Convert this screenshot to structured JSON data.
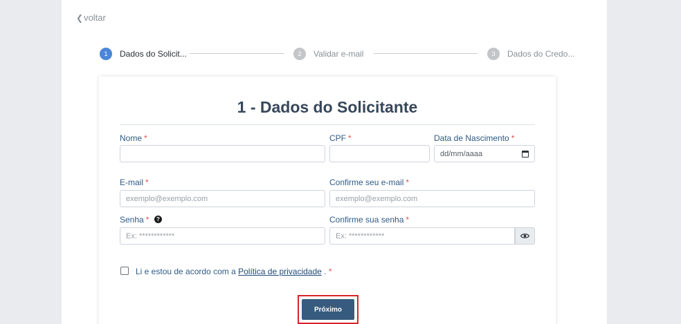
{
  "nav": {
    "back_label": "voltar"
  },
  "stepper": {
    "steps": [
      {
        "number": "1",
        "label": "Dados do Solicit..."
      },
      {
        "number": "2",
        "label": "Validar e-mail"
      },
      {
        "number": "3",
        "label": "Dados do Credo..."
      }
    ],
    "active_step": 1
  },
  "form": {
    "title": "1 - Dados do Solicitante",
    "required_mark": "*",
    "fields": {
      "nome": {
        "label": "Nome",
        "value": "",
        "placeholder": ""
      },
      "cpf": {
        "label": "CPF",
        "value": "",
        "placeholder": ""
      },
      "nascimento": {
        "label": "Data de Nascimento",
        "placeholder": "dd/mm/aaaa"
      },
      "email": {
        "label": "E-mail",
        "placeholder": "exemplo@exemplo.com"
      },
      "email_confirm": {
        "label": "Confirme seu e-mail",
        "placeholder": "exemplo@exemplo.com"
      },
      "senha": {
        "label": "Senha",
        "placeholder": "Ex: ************"
      },
      "senha_confirm": {
        "label": "Confirme sua senha",
        "placeholder": "Ex: ************"
      }
    },
    "consent": {
      "text_before": "Li e estou de acordo com a ",
      "link_text": "Política de privacidade",
      "text_after": " . "
    },
    "submit_label": "Próximo"
  },
  "colors": {
    "accent": "#4a86d9",
    "button": "#365b7e",
    "label": "#2e5a85",
    "required": "#d9534f",
    "highlight": "#d9232a"
  },
  "icons": {
    "help": "question-circle-icon",
    "eye": "eye-icon",
    "calendar": "calendar-icon",
    "back": "chevron-left-icon"
  }
}
